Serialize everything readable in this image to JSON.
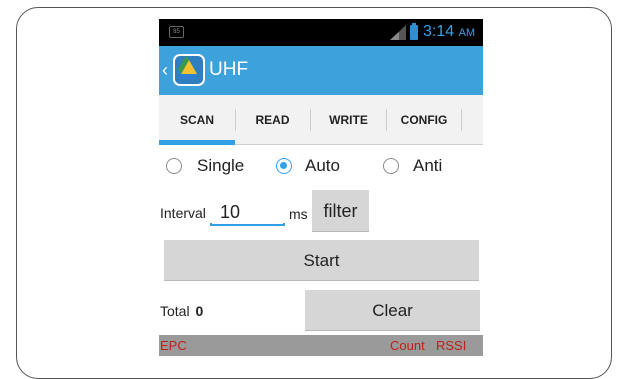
{
  "status_bar": {
    "time": "3:14",
    "ampm": "AM",
    "app_icon_text": "85",
    "accent_color": "#33a0e6"
  },
  "action_bar": {
    "title": "UHF",
    "color": "#3da1dc",
    "icons": [
      "chevron-left-icon",
      "app-logo-icon"
    ]
  },
  "tabs": [
    {
      "label": "SCAN",
      "selected": true
    },
    {
      "label": "READ",
      "selected": false
    },
    {
      "label": "WRITE",
      "selected": false
    },
    {
      "label": "CONFIG",
      "selected": false
    }
  ],
  "scan_mode": {
    "options": [
      {
        "label": "Single",
        "checked": false
      },
      {
        "label": "Auto",
        "checked": true
      },
      {
        "label": "Anti",
        "checked": false
      }
    ]
  },
  "interval": {
    "label": "Interval",
    "value": "10",
    "unit": "ms"
  },
  "buttons": {
    "filter": "filter",
    "start": "Start",
    "clear": "Clear"
  },
  "total": {
    "label": "Total",
    "count": "0"
  },
  "table_header": {
    "epc": "EPC",
    "count": "Count",
    "rssi": "RSSI",
    "text_color": "#c0201a"
  }
}
